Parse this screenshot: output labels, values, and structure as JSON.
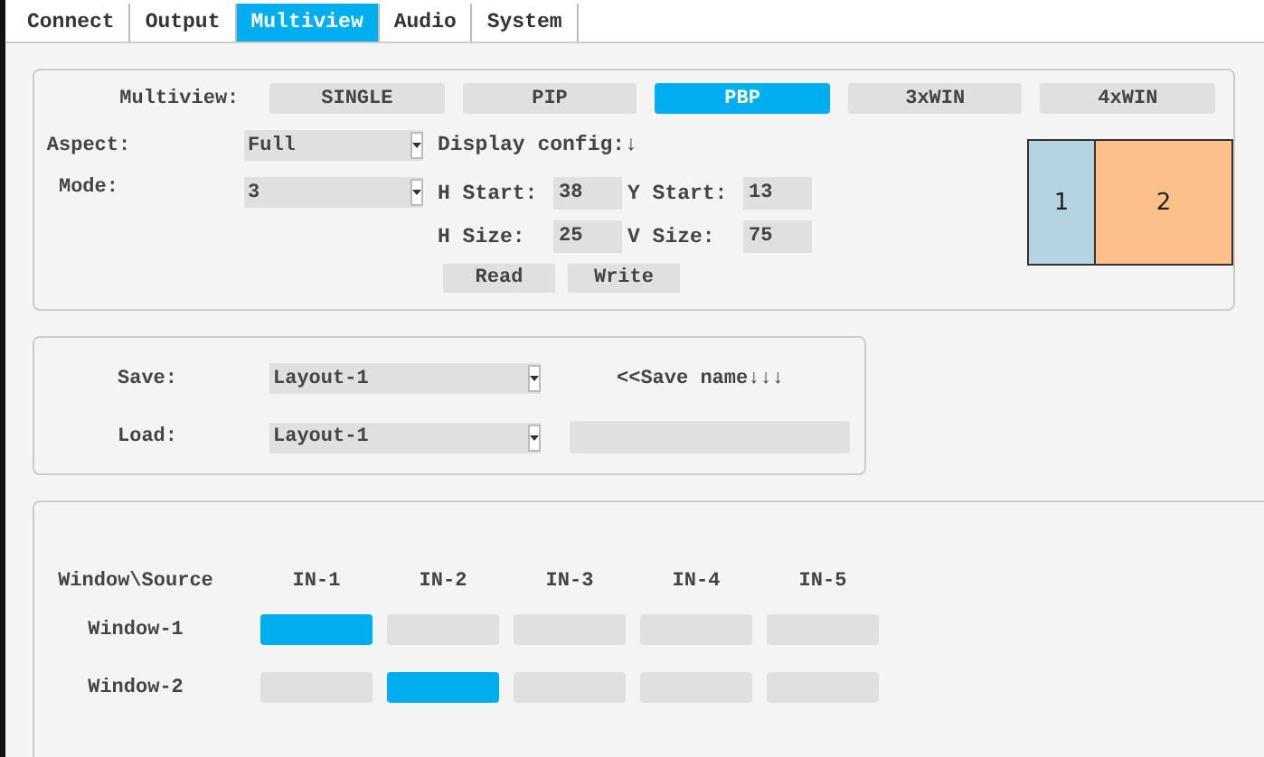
{
  "tabs": [
    {
      "label": "Connect",
      "selected": false
    },
    {
      "label": "Output",
      "selected": false
    },
    {
      "label": "Multiview",
      "selected": true
    },
    {
      "label": "Audio",
      "selected": false
    },
    {
      "label": "System",
      "selected": false
    }
  ],
  "multiview": {
    "label": "Multiview:",
    "modes": [
      {
        "label": "SINGLE",
        "selected": false
      },
      {
        "label": "PIP",
        "selected": false
      },
      {
        "label": "PBP",
        "selected": true
      },
      {
        "label": "3xWIN",
        "selected": false
      },
      {
        "label": "4xWIN",
        "selected": false
      }
    ],
    "aspect": {
      "label": "Aspect:",
      "value": "Full"
    },
    "mode": {
      "label": "Mode:",
      "value": "3"
    },
    "display_config": "Display config:↓",
    "fields": [
      {
        "label": "H Start:",
        "value": "38"
      },
      {
        "label": "Y Start:",
        "value": "13"
      },
      {
        "label": "H Size:",
        "value": "25"
      },
      {
        "label": "V Size:",
        "value": "75"
      }
    ],
    "buttons": [
      "Read",
      "Write"
    ],
    "preview": [
      {
        "label": "1",
        "color": "#b3d4e0"
      },
      {
        "label": "2",
        "color": "#fdc08a"
      }
    ]
  },
  "layout": {
    "save": {
      "label": "Save:",
      "value": "Layout-1"
    },
    "save_name_hint": "<<Save name↓↓↓",
    "load": {
      "label": "Load:",
      "value": "Layout-1"
    }
  },
  "routing": {
    "corner": "Window\\Source",
    "sources": [
      "IN-1",
      "IN-2",
      "IN-3",
      "IN-4",
      "IN-5"
    ],
    "rows": [
      {
        "label": "Window-1",
        "cells": [
          {
            "selected": true
          },
          {
            "selected": false
          },
          {
            "selected": false
          },
          {
            "selected": false
          },
          {
            "selected": false
          }
        ]
      },
      {
        "label": "Window-2",
        "cells": [
          {
            "selected": false
          },
          {
            "selected": true
          },
          {
            "selected": false
          },
          {
            "selected": false
          },
          {
            "selected": false
          }
        ]
      }
    ]
  }
}
